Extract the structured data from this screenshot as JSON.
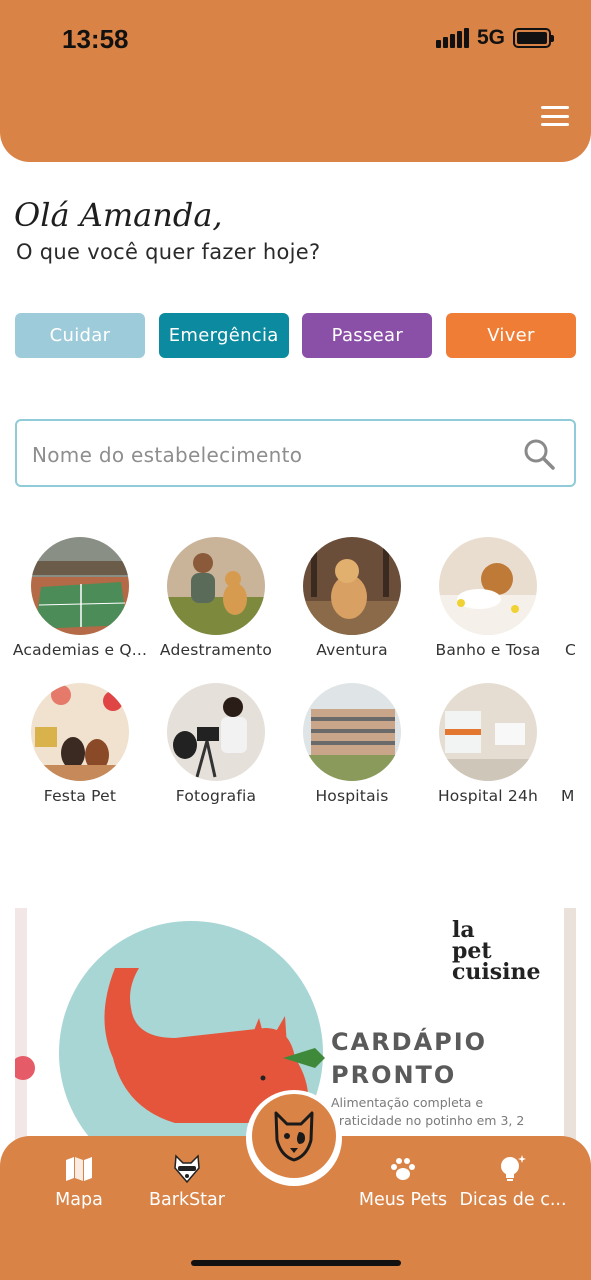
{
  "status_bar": {
    "time": "13:58",
    "network": "5G"
  },
  "greeting": {
    "title": "Olá Amanda,",
    "subtitle": "O que você quer fazer hoje?"
  },
  "categories": [
    {
      "label": "Cuidar",
      "color": "#9DCBDA"
    },
    {
      "label": "Emergência",
      "color": "#0C8A9F"
    },
    {
      "label": "Passear",
      "color": "#8A4FA6"
    },
    {
      "label": "Viver",
      "color": "#F07D36"
    }
  ],
  "search": {
    "placeholder": "Nome do estabelecimento"
  },
  "services_row1": [
    {
      "label": "Academias e Q..."
    },
    {
      "label": "Adestramento"
    },
    {
      "label": "Aventura"
    },
    {
      "label": "Banho e Tosa"
    },
    {
      "label": "C"
    }
  ],
  "services_row2": [
    {
      "label": "Festa Pet"
    },
    {
      "label": "Fotografia"
    },
    {
      "label": "Hospitais"
    },
    {
      "label": "Hospital 24h"
    },
    {
      "label": "M"
    }
  ],
  "banner": {
    "brand_line1": "la",
    "brand_line2": "pet",
    "brand_line3": "cuisine",
    "title_line1": "CARDÁPIO",
    "title_line2": "PRONTO",
    "subtitle": "Alimentação completa e praticidade no potinho em 3, 2"
  },
  "bottom_nav": [
    {
      "label": "Mapa",
      "icon": "map-icon"
    },
    {
      "label": "BarkStar",
      "icon": "barkstar-icon"
    },
    {
      "label": "Meus Pets",
      "icon": "paw-icon"
    },
    {
      "label": "Dicas de c...",
      "icon": "lightbulb-icon"
    }
  ],
  "colors": {
    "primary": "#D98346",
    "accent_orange": "#F07D36",
    "teal": "#0C8A9F",
    "purple": "#8A4FA6",
    "light_blue": "#9DCBDA"
  }
}
